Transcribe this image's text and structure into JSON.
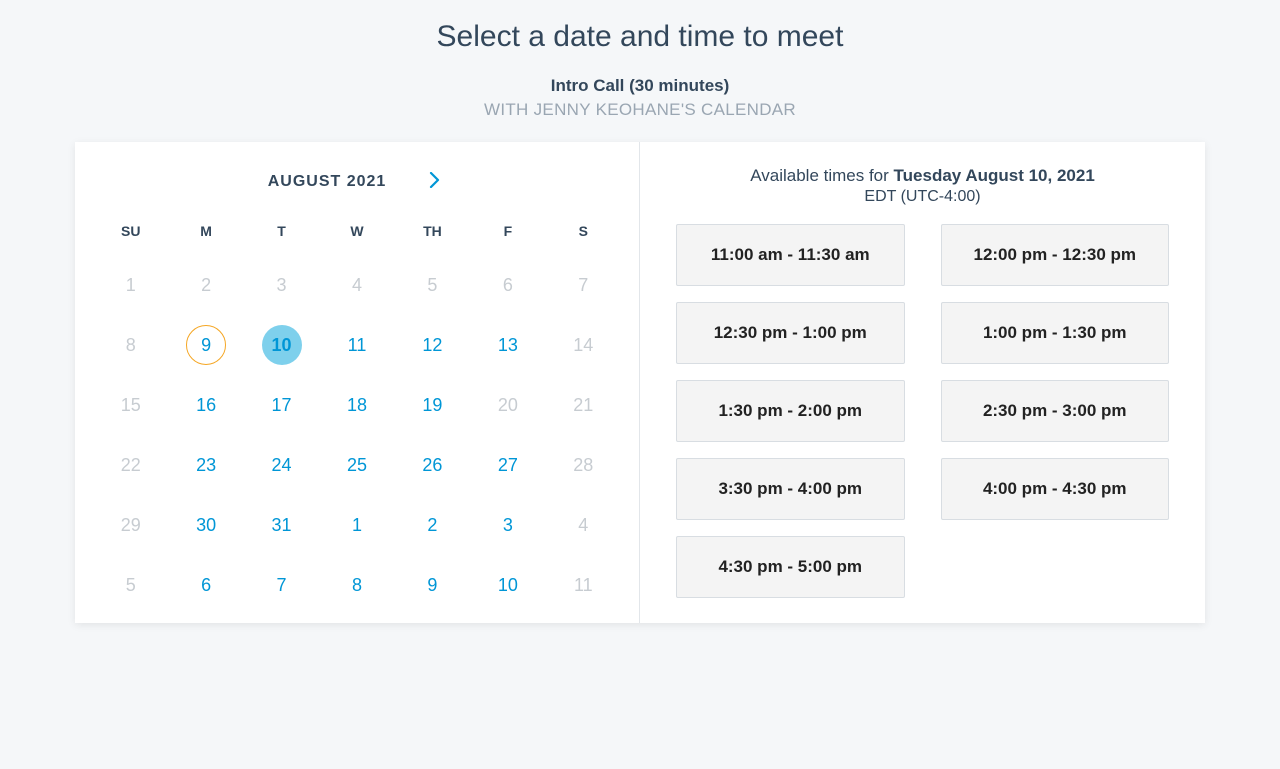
{
  "header": {
    "title": "Select a date and time to meet",
    "meeting_name": "Intro Call (30 minutes)",
    "host_line": "WITH JENNY KEOHANE'S CALENDAR"
  },
  "calendar": {
    "month_label": "AUGUST  2021",
    "dow": [
      "SU",
      "M",
      "T",
      "W",
      "TH",
      "F",
      "S"
    ],
    "days": [
      {
        "n": "1",
        "state": "disabled"
      },
      {
        "n": "2",
        "state": "disabled"
      },
      {
        "n": "3",
        "state": "disabled"
      },
      {
        "n": "4",
        "state": "disabled"
      },
      {
        "n": "5",
        "state": "disabled"
      },
      {
        "n": "6",
        "state": "disabled"
      },
      {
        "n": "7",
        "state": "disabled"
      },
      {
        "n": "8",
        "state": "disabled"
      },
      {
        "n": "9",
        "state": "today"
      },
      {
        "n": "10",
        "state": "selected"
      },
      {
        "n": "11",
        "state": "available"
      },
      {
        "n": "12",
        "state": "available"
      },
      {
        "n": "13",
        "state": "available"
      },
      {
        "n": "14",
        "state": "disabled"
      },
      {
        "n": "15",
        "state": "disabled"
      },
      {
        "n": "16",
        "state": "available"
      },
      {
        "n": "17",
        "state": "available"
      },
      {
        "n": "18",
        "state": "available"
      },
      {
        "n": "19",
        "state": "available"
      },
      {
        "n": "20",
        "state": "disabled"
      },
      {
        "n": "21",
        "state": "disabled"
      },
      {
        "n": "22",
        "state": "disabled"
      },
      {
        "n": "23",
        "state": "available"
      },
      {
        "n": "24",
        "state": "available"
      },
      {
        "n": "25",
        "state": "available"
      },
      {
        "n": "26",
        "state": "available"
      },
      {
        "n": "27",
        "state": "available"
      },
      {
        "n": "28",
        "state": "disabled"
      },
      {
        "n": "29",
        "state": "disabled"
      },
      {
        "n": "30",
        "state": "available"
      },
      {
        "n": "31",
        "state": "available"
      },
      {
        "n": "1",
        "state": "available"
      },
      {
        "n": "2",
        "state": "available"
      },
      {
        "n": "3",
        "state": "available"
      },
      {
        "n": "4",
        "state": "disabled"
      },
      {
        "n": "5",
        "state": "disabled"
      },
      {
        "n": "6",
        "state": "available"
      },
      {
        "n": "7",
        "state": "available"
      },
      {
        "n": "8",
        "state": "available"
      },
      {
        "n": "9",
        "state": "available"
      },
      {
        "n": "10",
        "state": "available"
      },
      {
        "n": "11",
        "state": "disabled"
      }
    ]
  },
  "times": {
    "prefix": "Available times for ",
    "selected_date": "Tuesday August 10, 2021",
    "timezone": "EDT (UTC-4:00)",
    "slots": [
      "11:00 am - 11:30 am",
      "12:00 pm - 12:30 pm",
      "12:30 pm - 1:00 pm",
      "1:00 pm - 1:30 pm",
      "1:30 pm - 2:00 pm",
      "2:30 pm - 3:00 pm",
      "3:30 pm - 4:00 pm",
      "4:00 pm - 4:30 pm",
      "4:30 pm - 5:00 pm"
    ]
  }
}
